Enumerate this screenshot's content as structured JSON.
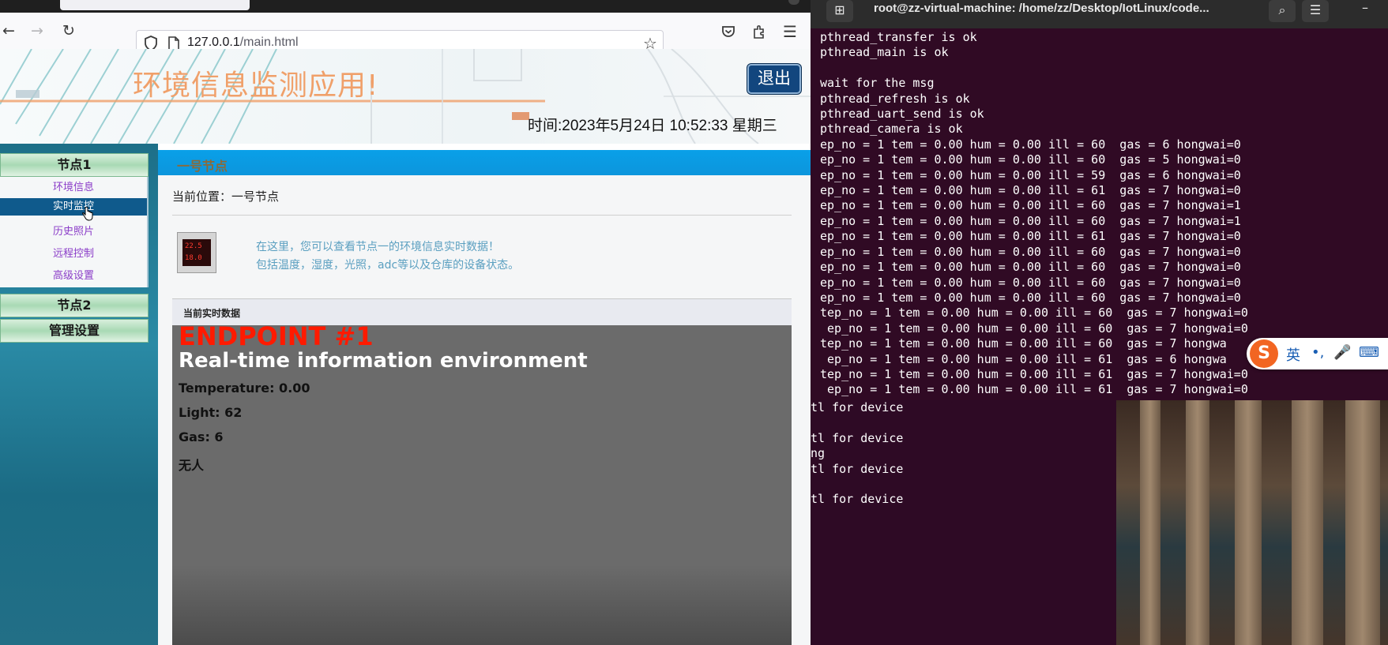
{
  "browser": {
    "url_host": "127.0.0.1",
    "url_path": "/main.html",
    "icons": [
      "back-icon",
      "forward-icon",
      "reload-icon",
      "shield-icon",
      "bookmark-star-icon",
      "pocket-icon",
      "extensions-icon",
      "menu-icon"
    ]
  },
  "page": {
    "title": "环境信息监测应用!",
    "logout": "退出",
    "datetime": "时间:2023年5月24日 10:52:33 星期三"
  },
  "sidebar": {
    "section1": "节点1",
    "items": [
      "环境信息",
      "实时监控",
      "历史照片",
      "远程控制",
      "高级设置"
    ],
    "active_index": 1,
    "section2": "节点2",
    "section3": "管理设置"
  },
  "main": {
    "bar_title": "一号节点",
    "location": "当前位置：一号节点",
    "intro1": "在这里，您可以查看节点一的环境信息实时数据！",
    "intro2": "包括温度，湿度，光照，adc等以及仓库的设备状态。",
    "realtime_label": "当前实时数据",
    "device_digits": [
      "22.5",
      "18.0"
    ],
    "endpoint_title": "ENDPOINT #1",
    "endpoint_subtitle": "Real-time information environment",
    "temperature": "Temperature: 0.00",
    "light": "Light: 62",
    "gas": "Gas: 6",
    "presence": "无人"
  },
  "terminal": {
    "title": "root@zz-virtual-machine: /home/zz/Desktop/IotLinux/code...",
    "lines": [
      "pthread_transfer is ok",
      "pthread_main is ok",
      "",
      "wait for the msg",
      "pthread_refresh is ok",
      "pthread_uart_send is ok",
      "pthread_camera is ok",
      "ep_no = 1 tem = 0.00 hum = 0.00 ill = 60  gas = 6 hongwai=0",
      "ep_no = 1 tem = 0.00 hum = 0.00 ill = 60  gas = 5 hongwai=0",
      "ep_no = 1 tem = 0.00 hum = 0.00 ill = 59  gas = 6 hongwai=0",
      "ep_no = 1 tem = 0.00 hum = 0.00 ill = 61  gas = 7 hongwai=0",
      "ep_no = 1 tem = 0.00 hum = 0.00 ill = 60  gas = 7 hongwai=1",
      "ep_no = 1 tem = 0.00 hum = 0.00 ill = 60  gas = 7 hongwai=1",
      "ep_no = 1 tem = 0.00 hum = 0.00 ill = 61  gas = 7 hongwai=0",
      "ep_no = 1 tem = 0.00 hum = 0.00 ill = 60  gas = 7 hongwai=0",
      "ep_no = 1 tem = 0.00 hum = 0.00 ill = 60  gas = 7 hongwai=0",
      "ep_no = 1 tem = 0.00 hum = 0.00 ill = 60  gas = 7 hongwai=0",
      "ep_no = 1 tem = 0.00 hum = 0.00 ill = 60  gas = 7 hongwai=0",
      "tep_no = 1 tem = 0.00 hum = 0.00 ill = 60  gas = 7 hongwai=0",
      " ep_no = 1 tem = 0.00 hum = 0.00 ill = 60  gas = 7 hongwai=0",
      "tep_no = 1 tem = 0.00 hum = 0.00 ill = 60  gas = 7 hongwa",
      " ep_no = 1 tem = 0.00 hum = 0.00 ill = 61  gas = 6 hongwa",
      "tep_no = 1 tem = 0.00 hum = 0.00 ill = 61  gas = 7 hongwai=0",
      " ep_no = 1 tem = 0.00 hum = 0.00 ill = 61  gas = 7 hongwai=0"
    ],
    "lower_lines": [
      "tl for device",
      "",
      "tl for device",
      "ng",
      "tl for device",
      "",
      "tl for device"
    ],
    "ime": {
      "lang": "英",
      "punct": "•,"
    }
  },
  "colors": {
    "terminal_bg": "#300a24",
    "title_orange": "#f0a06a",
    "endpoint_red": "#ff1a00",
    "active_item": "#0f5a8c"
  }
}
